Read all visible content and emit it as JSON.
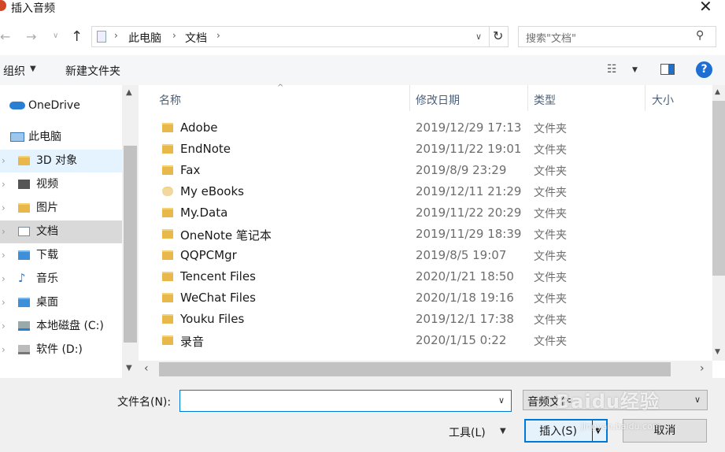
{
  "window": {
    "title": "插入音频"
  },
  "address": {
    "segments": [
      "此电脑",
      "文档"
    ]
  },
  "search": {
    "placeholder": "搜索\"文档\""
  },
  "toolbar": {
    "organize": "组织",
    "new_folder": "新建文件夹"
  },
  "nav": {
    "onedrive": "OneDrive",
    "this_pc": "此电脑",
    "items": [
      {
        "label": "3D 对象",
        "icon": "3d-objects-icon"
      },
      {
        "label": "视频",
        "icon": "videos-icon"
      },
      {
        "label": "图片",
        "icon": "pictures-icon"
      },
      {
        "label": "文档",
        "icon": "documents-icon"
      },
      {
        "label": "下载",
        "icon": "downloads-icon"
      },
      {
        "label": "音乐",
        "icon": "music-icon"
      },
      {
        "label": "桌面",
        "icon": "desktop-icon"
      },
      {
        "label": "本地磁盘 (C:)",
        "icon": "drive-c-icon"
      },
      {
        "label": "软件 (D:)",
        "icon": "drive-d-icon"
      }
    ]
  },
  "columns": {
    "name": "名称",
    "date": "修改日期",
    "type": "类型",
    "size": "大小"
  },
  "files": [
    {
      "name": "Adobe",
      "date": "2019/12/29 17:13",
      "type": "文件夹"
    },
    {
      "name": "EndNote",
      "date": "2019/11/22 19:01",
      "type": "文件夹"
    },
    {
      "name": "Fax",
      "date": "2019/8/9 23:29",
      "type": "文件夹"
    },
    {
      "name": "My eBooks",
      "date": "2019/12/11 21:29",
      "type": "文件夹"
    },
    {
      "name": "My.Data",
      "date": "2019/11/22 20:29",
      "type": "文件夹"
    },
    {
      "name": "OneNote 笔记本",
      "date": "2019/11/29 18:39",
      "type": "文件夹"
    },
    {
      "name": "QQPCMgr",
      "date": "2019/8/5 19:07",
      "type": "文件夹"
    },
    {
      "name": "Tencent Files",
      "date": "2020/1/21 18:50",
      "type": "文件夹"
    },
    {
      "name": "WeChat Files",
      "date": "2020/1/18 19:16",
      "type": "文件夹"
    },
    {
      "name": "Youku Files",
      "date": "2019/12/1 17:38",
      "type": "文件夹"
    },
    {
      "name": "录音",
      "date": "2020/1/15 0:22",
      "type": "文件夹"
    }
  ],
  "bottom": {
    "filename_label": "文件名(N):",
    "filename_value": "",
    "filetype_value": "音频文件",
    "tools": "工具(L)",
    "insert": "插入(S)",
    "cancel": "取消"
  },
  "watermark": {
    "text": "Baidu经验",
    "url": "jingyan.baidu.com"
  }
}
